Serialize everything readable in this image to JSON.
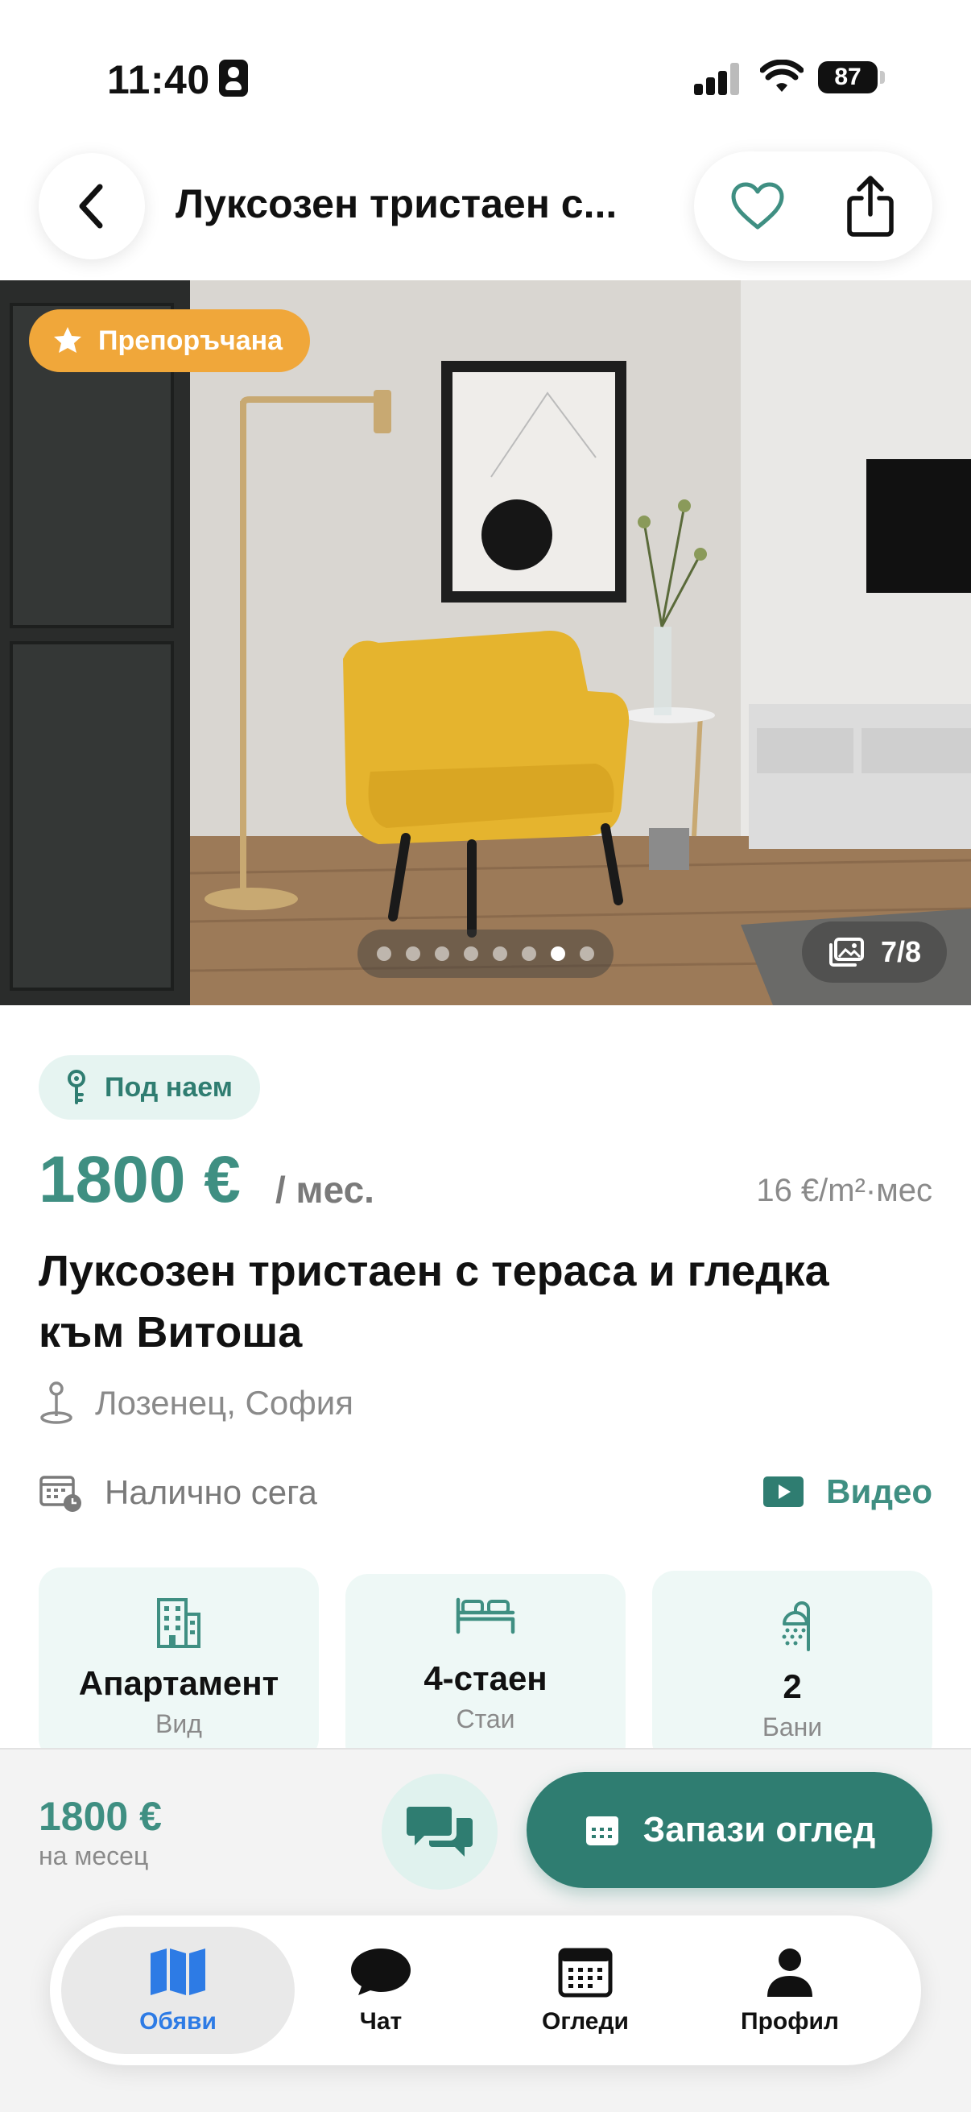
{
  "status_bar": {
    "time": "11:40",
    "battery": "87"
  },
  "header": {
    "title": "Луксозен тристаен с..."
  },
  "gallery": {
    "badge": "Препоръчана",
    "counter": "7/8",
    "total_photos": 8,
    "current_photo": 7
  },
  "listing": {
    "type_chip": "Под наем",
    "price": "1800 €",
    "price_unit": "/ мес.",
    "price_per_sqm": "16 €/m²·мес",
    "title": "Луксозен тристаен с тераса и гледка към Витоша",
    "location": "Лозенец, София",
    "availability": "Налично сега",
    "video_label": "Видео"
  },
  "features": [
    {
      "value": "Апартамент",
      "label": "Вид",
      "icon": "building-icon"
    },
    {
      "value": "4-стаен",
      "label": "Стаи",
      "icon": "bed-icon"
    },
    {
      "value": "2",
      "label": "Бани",
      "icon": "shower-icon"
    }
  ],
  "bottom_bar": {
    "price": "1800 €",
    "period": "на месец",
    "book_label": "Запази оглед"
  },
  "tabs": [
    {
      "label": "Обяви",
      "icon": "map-icon",
      "active": true
    },
    {
      "label": "Чат",
      "icon": "chat-bubble-icon",
      "active": false
    },
    {
      "label": "Огледи",
      "icon": "calendar-icon",
      "active": false
    },
    {
      "label": "Профил",
      "icon": "person-icon",
      "active": false
    }
  ],
  "colors": {
    "accent": "#3f8f82",
    "accent_dark": "#2f7d71",
    "featured": "#f0a73a",
    "active_tab": "#2d7be5"
  }
}
